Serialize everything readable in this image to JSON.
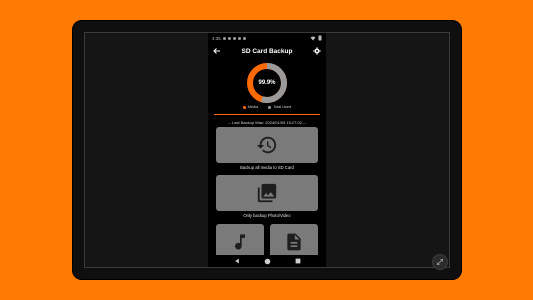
{
  "status_bar": {
    "time": "4:35",
    "icons": [
      "notification-dot",
      "notification-dot",
      "notification-dot",
      "notification-dot",
      "notification-dot",
      "wifi-icon",
      "battery-icon"
    ]
  },
  "header": {
    "title": "SD Card Backup",
    "back_icon": "arrow-left-icon",
    "settings_icon": "gear-icon"
  },
  "storage": {
    "percent_label": "99.9%",
    "percent_value": 99.9,
    "legend": [
      {
        "label": "Media",
        "color": "#ff6a00"
      },
      {
        "label": "Total Used",
        "color": "#9a9a9a"
      }
    ]
  },
  "last_backup": {
    "text": "-- Last Backup Was: 2024/01/09 15:27:02 --"
  },
  "actions": {
    "backup_all": {
      "label": "Backup all media to SD Card",
      "icon": "restore-history-icon"
    },
    "photo_video": {
      "label": "Only backup Photo/Video",
      "icon": "photo-library-icon"
    },
    "music": {
      "label": "",
      "icon": "music-note-icon"
    },
    "documents": {
      "label": "",
      "icon": "document-icon"
    }
  },
  "nav_bar": {
    "back": "nav-back-icon",
    "home": "nav-home-icon",
    "recents": "nav-recents-icon"
  },
  "colors": {
    "accent": "#ff6a00",
    "background": "#ff7a00",
    "button": "#7a7a7a"
  }
}
